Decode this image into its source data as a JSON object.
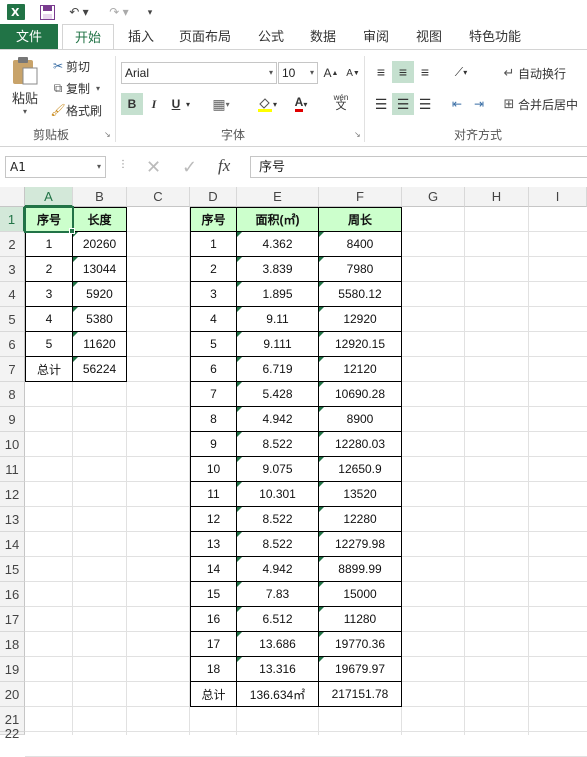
{
  "quick_access": {
    "icons": [
      "excel-logo-icon",
      "save-icon",
      "undo-icon",
      "redo-icon",
      "customize-qat-icon"
    ]
  },
  "tabs": [
    {
      "label": "文件",
      "key": "file"
    },
    {
      "label": "开始",
      "key": "home"
    },
    {
      "label": "插入",
      "key": "insert"
    },
    {
      "label": "页面布局",
      "key": "layout"
    },
    {
      "label": "公式",
      "key": "formulas"
    },
    {
      "label": "数据",
      "key": "data"
    },
    {
      "label": "审阅",
      "key": "review"
    },
    {
      "label": "视图",
      "key": "view"
    },
    {
      "label": "特色功能",
      "key": "special"
    }
  ],
  "ribbon": {
    "clipboard": {
      "paste": "粘贴",
      "cut": "剪切",
      "copy": "复制",
      "format_painter": "格式刷",
      "group": "剪贴板"
    },
    "font": {
      "font_name": "Arial",
      "font_size": "10",
      "bold": "B",
      "italic": "I",
      "underline": "U",
      "phonetic": "wén",
      "phonetic_sub": "文",
      "group": "字体"
    },
    "alignment": {
      "wrap_text": "自动换行",
      "merge_center": "合并后居中",
      "group": "对齐方式"
    }
  },
  "formula_bar": {
    "name_box": "A1",
    "fx": "fx",
    "content": "序号"
  },
  "columns": [
    "A",
    "B",
    "C",
    "D",
    "E",
    "F",
    "G",
    "H",
    "I"
  ],
  "rows": [
    "1",
    "2",
    "3",
    "4",
    "5",
    "6",
    "7",
    "8",
    "9",
    "10",
    "11",
    "12",
    "13",
    "14",
    "15",
    "16",
    "17",
    "18",
    "19",
    "20",
    "21",
    "22"
  ],
  "table1": {
    "headers": [
      "序号",
      "长度"
    ],
    "rows": [
      [
        "1",
        "20260"
      ],
      [
        "2",
        "13044"
      ],
      [
        "3",
        "5920"
      ],
      [
        "4",
        "5380"
      ],
      [
        "5",
        "11620"
      ],
      [
        "总计",
        "56224"
      ]
    ]
  },
  "table2": {
    "headers": [
      "序号",
      "面积(㎡)",
      "周长"
    ],
    "rows": [
      [
        "1",
        "4.362",
        "8400"
      ],
      [
        "2",
        "3.839",
        "7980"
      ],
      [
        "3",
        "1.895",
        "5580.12"
      ],
      [
        "4",
        "9.11",
        "12920"
      ],
      [
        "5",
        "9.111",
        "12920.15"
      ],
      [
        "6",
        "6.719",
        "12120"
      ],
      [
        "7",
        "5.428",
        "10690.28"
      ],
      [
        "8",
        "4.942",
        "8900"
      ],
      [
        "9",
        "8.522",
        "12280.03"
      ],
      [
        "10",
        "9.075",
        "12650.9"
      ],
      [
        "11",
        "10.301",
        "13520"
      ],
      [
        "12",
        "8.522",
        "12280"
      ],
      [
        "13",
        "8.522",
        "12279.98"
      ],
      [
        "14",
        "4.942",
        "8899.99"
      ],
      [
        "15",
        "7.83",
        "15000"
      ],
      [
        "16",
        "6.512",
        "11280"
      ],
      [
        "17",
        "13.686",
        "19770.36"
      ],
      [
        "18",
        "13.316",
        "19679.97"
      ],
      [
        "总计",
        "136.634㎡",
        "217151.78"
      ]
    ]
  },
  "colors": {
    "accent": "#217346",
    "header_fill": "#ccffcc"
  }
}
